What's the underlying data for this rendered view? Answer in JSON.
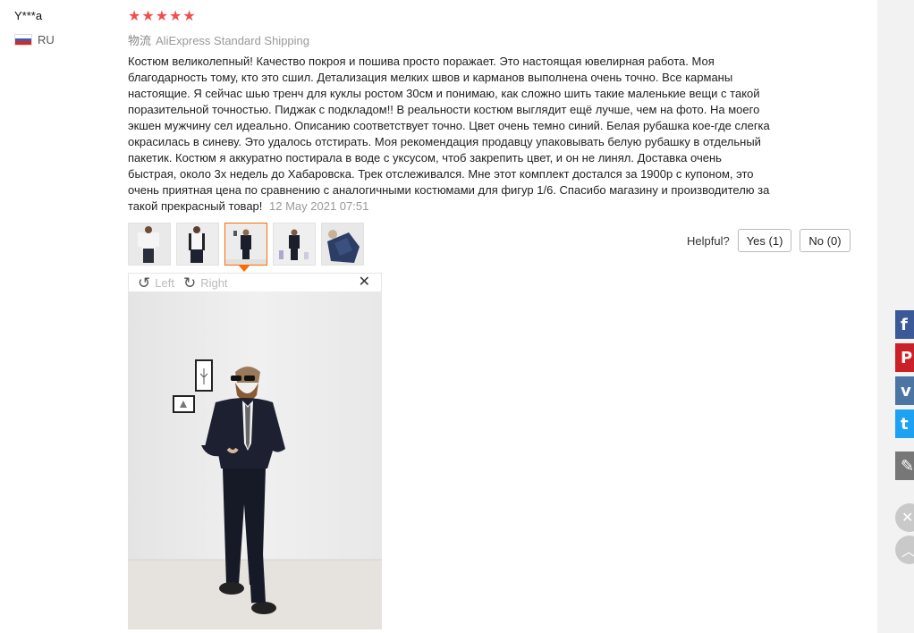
{
  "review": {
    "user_name": "Y***a",
    "country": "RU",
    "rating": 5,
    "stars": [
      "★",
      "★",
      "★",
      "★",
      "★"
    ],
    "shipping_label": "物流",
    "shipping_method": "AliExpress Standard Shipping",
    "text": "Костюм великолепный! Качество покроя и пошива просто поражает. Это настоящая ювелирная работа. Моя благодарность тому, кто это сшил. Детализация мелких швов и карманов выполнена очень точно. Все карманы настоящие. Я сейчас шью тренч для куклы ростом 30см и понимаю, как сложно шить такие маленькие вещи с такой поразительной точностью. Пиджак с подкладом!! В реальности костюм выглядит ещё лучше, чем на фото. На моего экшен мужчину сел идеально. Описанию соответствует точно. Цвет очень темно синий. Белая рубашка кое-где слегка окрасилась в синеву. Это удалось отстирать. Моя рекомендация продавцу упаковывать белую рубашку в отдельный пакетик. Костюм я аккуратно постирала в воде с уксусом, чтоб закрепить цвет, и он не линял. Доставка очень быстрая, около 3х недель до Хабаровска. Трек отслеживался. Мне этот комплект достался за 1900р с купоном, это очень приятная цена по сравнению с аналогичными костюмами для фигур 1/6. Спасибо магазину и производителю за такой прекрасный товар!",
    "date": "12 May 2021 07:51"
  },
  "helpful": {
    "label": "Helpful?",
    "yes_label": "Yes (1)",
    "no_label": "No (0)"
  },
  "viewer": {
    "rotate_left_label": "Left",
    "rotate_right_label": "Right",
    "close_icon": "close-icon",
    "selected_thumbnail": 3
  },
  "sidebar_share": [
    "facebook-icon",
    "pinterest-icon",
    "vk-icon",
    "twitter-icon",
    "edit-icon"
  ],
  "colors": {
    "star": "#f04e4e",
    "active_thumb": "#ff6a00",
    "facebook": "#3b5998",
    "pinterest": "#cb2027",
    "vk": "#4d75a3",
    "twitter": "#1da1f2",
    "edit": "#777777"
  }
}
